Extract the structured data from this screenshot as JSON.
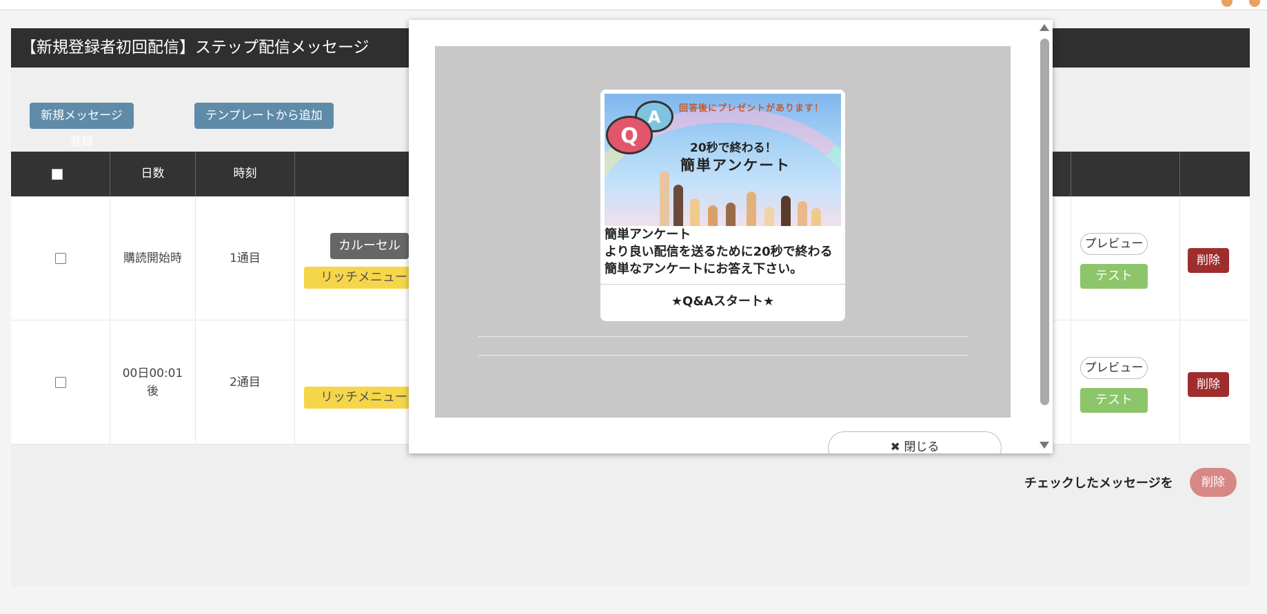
{
  "header": {
    "title": "【新規登録者初回配信】ステップ配信メッセージ"
  },
  "toolbar": {
    "new_message_label": "新規メッセージ登録",
    "from_template_label": "テンプレートから追加"
  },
  "table": {
    "headers": {
      "days": "日数",
      "time": "時刻"
    },
    "rows": [
      {
        "days": "購読開始時",
        "time": "1通目",
        "type_tag": "カルーセル",
        "menu_tag": "リッチメニュー",
        "preview_label": "プレビュー",
        "test_label": "テスト",
        "delete_label": "削除"
      },
      {
        "days": "00日00:01後",
        "time": "2通目",
        "menu_tag": "リッチメニュー",
        "preview_label": "プレビュー",
        "test_label": "テスト",
        "delete_label": "削除"
      }
    ]
  },
  "footer": {
    "checked_label": "チェックしたメッセージを",
    "delete_label": "削除"
  },
  "modal": {
    "card": {
      "image_top_text": "回答後にプレゼントがあります！",
      "image_sub_text": "20秒で終わる！",
      "image_main_text": "簡単アンケート",
      "q_letter": "Q",
      "a_letter": "A",
      "title": "簡単アンケート",
      "text": "より良い配信を送るために20秒で終わる簡単なアンケートにお答え下さい。",
      "action_label": "★Q&Aスタート★"
    },
    "close_label": "✖ 閉じる"
  },
  "colors": {
    "header_bg": "#2f2f2f",
    "button_blue": "#5f8ba9",
    "test_green": "#8cc56a",
    "delete_red": "#9f2d2d",
    "tag_yellow": "#f5d64a"
  }
}
